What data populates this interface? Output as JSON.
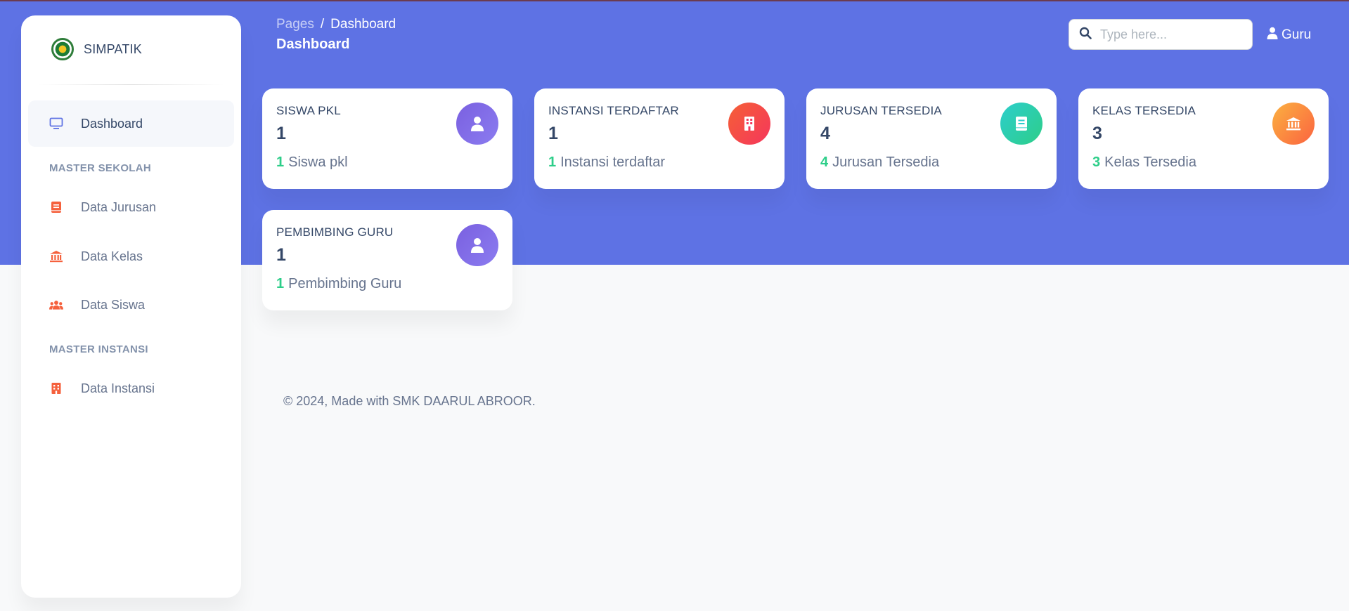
{
  "brand": {
    "name": "SIMPATIK"
  },
  "sidebar": {
    "items": [
      {
        "label": "Dashboard",
        "icon": "monitor-icon",
        "active": true
      },
      {
        "section": "MASTER SEKOLAH"
      },
      {
        "label": "Data Jurusan",
        "icon": "book-icon"
      },
      {
        "label": "Data Kelas",
        "icon": "institution-icon"
      },
      {
        "label": "Data Siswa",
        "icon": "users-icon"
      },
      {
        "section": "MASTER INSTANSI"
      },
      {
        "label": "Data Instansi",
        "icon": "building-icon"
      }
    ]
  },
  "header": {
    "breadcrumb": [
      "Pages",
      "Dashboard"
    ],
    "separator": "/",
    "title": "Dashboard",
    "search_placeholder": "Type here...",
    "user_label": "Guru"
  },
  "cards": [
    {
      "title": "SISWA PKL",
      "value": "1",
      "foot_num": "1",
      "foot_text": "Siswa pkl",
      "icon": "user-icon",
      "color": "#7a60e0"
    },
    {
      "title": "INSTANSI TERDAFTAR",
      "value": "1",
      "foot_num": "1",
      "foot_text": "Instansi terdaftar",
      "icon": "building-icon",
      "color": "#f5365c"
    },
    {
      "title": "JURUSAN TERSEDIA",
      "value": "4",
      "foot_num": "4",
      "foot_text": "Jurusan Tersedia",
      "icon": "book-icon",
      "color": "#2dcecc"
    },
    {
      "title": "KELAS TERSEDIA",
      "value": "3",
      "foot_num": "3",
      "foot_text": "Kelas Tersedia",
      "icon": "institution-icon",
      "color": "#fb6340"
    },
    {
      "title": "PEMBIMBING GURU",
      "value": "1",
      "foot_num": "1",
      "foot_text": "Pembimbing Guru",
      "icon": "user-icon",
      "color": "#7a60e0"
    }
  ],
  "footer": {
    "text": "© 2024, Made with SMK DAARUL ABROOR."
  },
  "colors": {
    "primary": "#5e72e4",
    "success": "#2dce89",
    "sidebar_icon": "#f5613d"
  }
}
